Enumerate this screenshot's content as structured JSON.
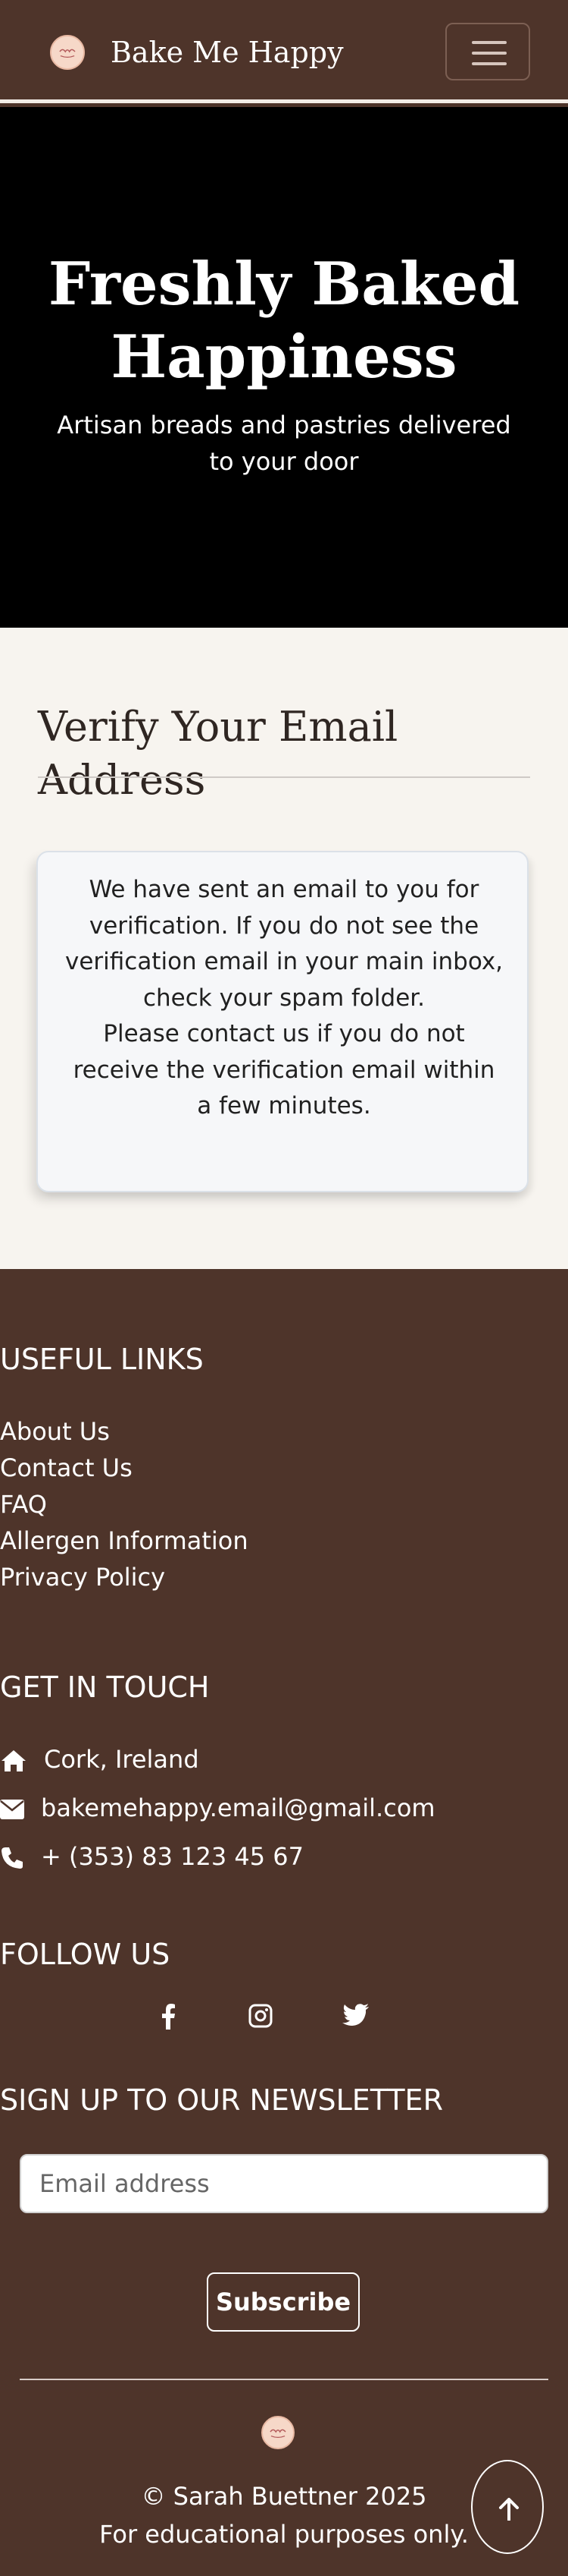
{
  "navbar": {
    "brand": "Bake Me Happy",
    "logo_icon": "bakery-logo-icon",
    "toggle_icon": "hamburger-menu-icon"
  },
  "hero": {
    "title": "Freshly Baked Happiness",
    "subtitle": "Artisan breads and pastries delivered to your door"
  },
  "main": {
    "heading": "Verify Your Email Address",
    "message_line1": "We have sent an email to you for verification. If you do not see the verification email in your main inbox, check your spam folder.",
    "message_line2": "Please contact us if you do not receive the verification email within a few minutes."
  },
  "footer": {
    "useful_links_heading": "USEFUL LINKS",
    "useful_links": [
      "About Us",
      "Contact Us",
      "FAQ",
      "Allergen Information",
      "Privacy Policy"
    ],
    "get_in_touch_heading": "GET IN TOUCH",
    "address": "Cork, Ireland",
    "email": "bakemehappy.email@gmail.com",
    "phone": "+ (353) 83 123 45 67",
    "follow_heading": "FOLLOW US",
    "social_icons": [
      "facebook-icon",
      "instagram-icon",
      "twitter-icon"
    ],
    "newsletter_heading": "SIGN UP TO OUR NEWSLETTER",
    "newsletter_placeholder": "Email address",
    "subscribe_label": "Subscribe",
    "copyright": "© Sarah Buettner 2025",
    "disclaimer": "For educational purposes only.",
    "back_to_top_icon": "arrow-up-icon"
  },
  "colors": {
    "brand_brown": "#4e342a",
    "page_cream": "#f7f4ef",
    "hero_black": "#000000",
    "card_bg": "#f6f7f9"
  }
}
